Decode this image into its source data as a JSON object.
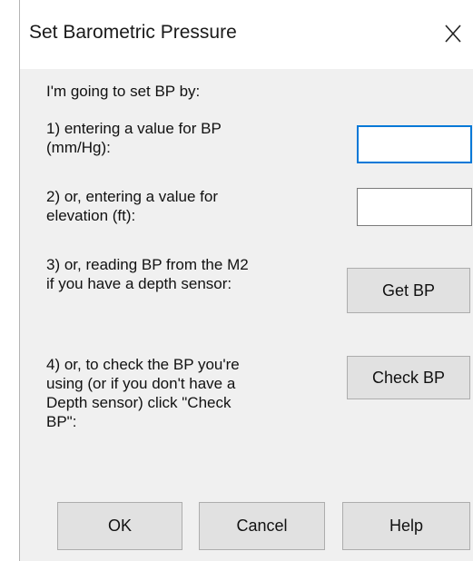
{
  "window": {
    "title": "Set Barometric Pressure",
    "close_icon": "close-icon"
  },
  "intro": "I'm going to set BP by:",
  "options": {
    "bp_value": {
      "label": "1) entering a value for BP\n(mm/Hg):",
      "value": "",
      "focused": true
    },
    "elevation": {
      "label": "2) or, entering a value for\nelevation (ft):",
      "value": ""
    },
    "read_m2": {
      "label": "3) or, reading BP from the M2\nif you have a depth sensor:",
      "button": "Get BP"
    },
    "check": {
      "label": "4) or, to check the BP you're\nusing (or if you don't have a\nDepth sensor) click \"Check\nBP\":",
      "button": "Check BP"
    }
  },
  "footer": {
    "ok": "OK",
    "cancel": "Cancel",
    "help": "Help"
  },
  "colors": {
    "dialog_bg": "#f0f0f0",
    "titlebar_bg": "#ffffff",
    "focus_border": "#0078d7",
    "button_bg": "#e1e1e1"
  }
}
